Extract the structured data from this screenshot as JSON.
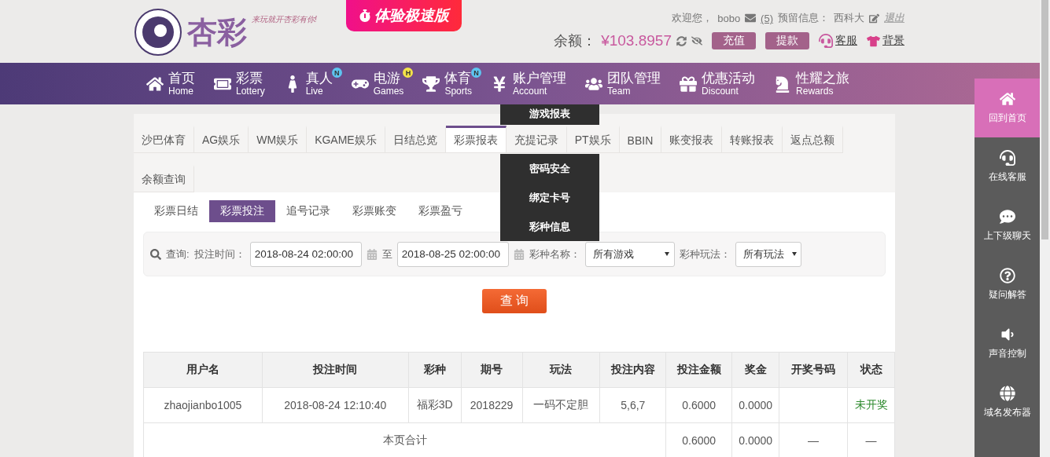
{
  "header": {
    "logo_text": "杏彩",
    "slogan": "来玩就开杏彩有你!",
    "promo_button": "体验极速版",
    "welcome": "欢迎您，",
    "username": "bobo",
    "messages": "(5)",
    "reserved_label": "预留信息：",
    "reserved_value": "西科大",
    "logout": "退出",
    "balance_label": "余额：",
    "balance": "¥103.8957",
    "buttons": [
      "充值",
      "提款"
    ],
    "links": [
      "客服",
      "背景"
    ]
  },
  "nav": {
    "items": [
      {
        "zh": "首页",
        "en": "Home"
      },
      {
        "zh": "彩票",
        "en": "Lottery"
      },
      {
        "zh": "真人",
        "en": "Live",
        "badge": "N",
        "color": "#5ec4f0"
      },
      {
        "zh": "电游",
        "en": "Games",
        "badge": "H",
        "color": "#f3e24a"
      },
      {
        "zh": "体育",
        "en": "Sports",
        "badge": "N",
        "color": "#5ec4f0"
      },
      {
        "zh": "账户管理",
        "en": "Account",
        "menu": [
          "游戏报表",
          "密码安全",
          "绑定卡号",
          "彩种信息"
        ]
      },
      {
        "zh": "团队管理",
        "en": "Team"
      },
      {
        "zh": "优惠活动",
        "en": "Discount"
      },
      {
        "zh": "性耀之旅",
        "en": "Rewards"
      }
    ]
  },
  "report_tabs": [
    {
      "label": "沙巴体育",
      "selected": false
    },
    {
      "label": "AG娱乐",
      "selected": false
    },
    {
      "label": "WM娱乐",
      "selected": false
    },
    {
      "label": "KGAME娱乐",
      "selected": false
    },
    {
      "label": "日结总览",
      "selected": false
    },
    {
      "label": "彩票报表",
      "selected": true
    },
    {
      "label": "充提记录",
      "selected": false
    },
    {
      "label": "PT娱乐",
      "selected": false
    },
    {
      "label": "BBIN",
      "selected": false
    },
    {
      "label": "账变报表",
      "selected": false
    },
    {
      "label": "转账报表",
      "selected": false
    },
    {
      "label": "返点总额",
      "selected": false
    },
    {
      "label": "余额查询",
      "selected": false
    }
  ],
  "sub_tabs": [
    {
      "label": "彩票日结",
      "selected": false
    },
    {
      "label": "彩票投注",
      "selected": true
    },
    {
      "label": "追号记录",
      "selected": false
    },
    {
      "label": "彩票账变",
      "selected": false
    },
    {
      "label": "彩票盈亏",
      "selected": false
    }
  ],
  "filter": {
    "query_label": "查询:",
    "time_label": "投注时间：",
    "start": "2018-08-24 02:00:00",
    "to": "至",
    "end": "2018-08-25 02:00:00",
    "game_label": "彩种名称：",
    "game_value": "所有游戏",
    "play_label": "彩种玩法：",
    "play_value": "所有玩法",
    "search_button": "查 询"
  },
  "table": {
    "columns": [
      "用户名",
      "投注时间",
      "彩种",
      "期号",
      "玩法",
      "投注内容",
      "投注金额",
      "奖金",
      "开奖号码",
      "状态"
    ],
    "rows": [
      {
        "cells": [
          "zhaojianbo1005",
          "2018-08-24 12:10:40",
          "福彩3D",
          "2018229",
          "一码不定胆",
          "5,6,7",
          "0.6000",
          "0.0000",
          ""
        ],
        "status": "未开奖"
      }
    ],
    "total": {
      "label": "本页合计",
      "values": [
        "0.6000",
        "0.0000",
        "—",
        "—"
      ]
    }
  },
  "sidebar": [
    {
      "label": "回到首页",
      "selected": true
    },
    {
      "label": "在线客服",
      "selected": false
    },
    {
      "label": "上下级聊天",
      "selected": false
    },
    {
      "label": "疑问解答",
      "selected": false
    },
    {
      "label": "声音控制",
      "selected": false
    },
    {
      "label": "域名发布器",
      "selected": false
    }
  ]
}
